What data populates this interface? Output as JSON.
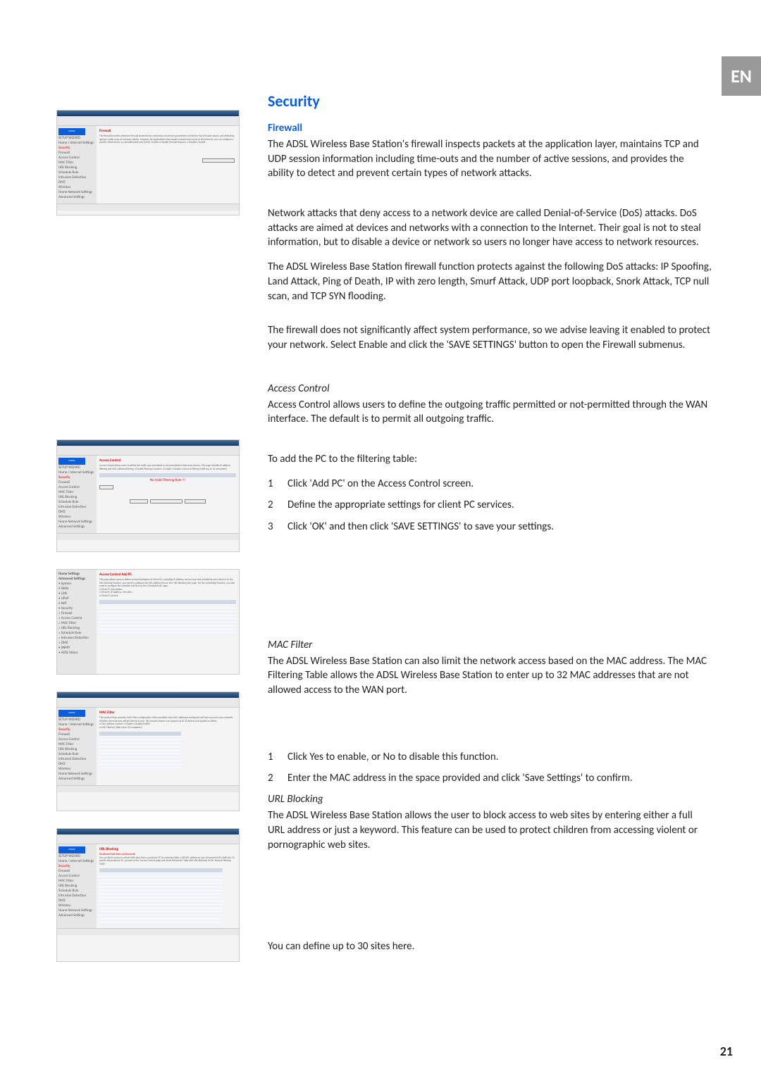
{
  "lang_tab": "EN",
  "page_number": "21",
  "section_title": "Security",
  "firewall": {
    "heading": "Firewall",
    "p1": "The ADSL Wireless Base Station's firewall inspects packets at the application layer, maintains TCP and UDP session information including time-outs and the number of active sessions, and provides the ability to detect and prevent certain types of network attacks.",
    "p2": "Network attacks that deny access to a network device are called Denial-of-Service (DoS) attacks. DoS attacks are aimed at devices and networks with a connection to the Internet. Their goal is not to steal information, but to disable a device or network so users no longer have access to network resources.",
    "p3": "The ADSL Wireless Base Station firewall function protects against the following DoS attacks: IP Spoofing, Land Attack, Ping of Death, IP with zero length, Smurf Attack, UDP port loopback, Snork Attack, TCP null scan, and TCP SYN flooding.",
    "p4": "The firewall does not significantly affect system performance, so we advise leaving it enabled to protect your network. Select Enable and click the 'SAVE SETTINGS' button to open the Firewall submenus."
  },
  "access_control": {
    "heading": "Access Control",
    "p1": "Access Control allows users to define the outgoing traffic permitted or not-permitted through the WAN interface. The default is to permit all outgoing traffic.",
    "lead": "To add the PC to the filtering table:",
    "steps": [
      "Click 'Add PC' on the Access Control screen.",
      "Define the appropriate settings for client PC services.",
      "Click 'OK' and then click 'SAVE SETTINGS' to save your settings."
    ]
  },
  "mac_filter": {
    "heading": "MAC Filter",
    "p1": "The ADSL Wireless Base Station can also limit the network access based on the MAC address. The MAC Filtering Table allows the ADSL Wireless Base Station to enter up to 32 MAC addresses that are not allowed access to the WAN port.",
    "steps": [
      "Click Yes to enable, or No to disable this function.",
      "Enter the MAC address in the space provided and click 'Save Settings' to confirm."
    ]
  },
  "url_blocking": {
    "heading": "URL Blocking",
    "p1": "The ADSL Wireless Base Station allows the user to block access to web sites by entering either a full URL address or just a keyword. This feature can be used to protect children from accessing violent or pornographic web sites.",
    "p2": "You can define up to 30 sites here."
  },
  "shot_common": {
    "logo": "PHILIPS"
  },
  "shot1": {
    "title": "Firewall",
    "sidebar": [
      "SETUP WIZARD",
      "Home / Internet Settings",
      "Security",
      "Firewall",
      "Access Control",
      "MAC Filter",
      "URL Blocking",
      "Schedule Rule",
      "Intrusion Detection",
      "DMZ",
      "Wireless",
      "Home Network Settings",
      "Advanced Settings"
    ],
    "text": "The firewall provides extensive firewall protection by restricting connection parameters to limit the risk of hacker attack, and defending against a wide array of common attacks. However, for applications that require unrestricted access to the Internet, you can configure a specific client/server as a demilitarized zone (DMZ). Enable or disable Firewall features: ○ Disable ○ Enable",
    "btn": "SAVE SETTINGS"
  },
  "shot2": {
    "title": "Access Control",
    "sidebar": [
      "SETUP WIZARD",
      "Home / Internet Settings",
      "Security",
      "Firewall",
      "Access Control",
      "MAC Filter",
      "URL Blocking",
      "Schedule Rule",
      "Intrusion Detection",
      "DMZ",
      "Wireless",
      "Home Network Settings",
      "Advanced Settings"
    ],
    "text": "Access Control allows users to define the traffic type permitted or not-permitted to WAN port service. This page includes IP address filtering and MAC address filtering. • Enable Filtering Function: ○ Enable ○ Disable • Normal Filtering Table (up to 10 computers)",
    "tbl_hdr": [
      "Rule Description",
      "Client PC IP Address",
      "Client Service",
      "Schedule Rule",
      "Configure"
    ],
    "tbl_msg": "No Valid Filtering Rule !!!",
    "btns": [
      "Add PC",
      "HELP",
      "SAVE SETTINGS",
      "CANCEL"
    ]
  },
  "shot3": {
    "title": "Access Control Add PC",
    "sidebar": [
      "Home Settings",
      "Advanced Settings",
      "• System",
      "• WAN",
      "• LAN",
      "• UPnP",
      "• NAT",
      "• Security",
      "  » Firewall",
      "  » Access Control",
      "  » MAC Filter",
      "  » URL Blocking",
      "  » Schedule Rule",
      "  » Intrusion Detection",
      "  » DMZ",
      "• SNMP",
      "• ADSL Status"
    ],
    "text": "This page allows users to define service limitations of client PCs, including IP address, service type and scheduling rule criteria. For the URL blocking function, you need to configure the URL address first on the 'URL Blocking Site' page. For the scheduling function, you also need to configure the schedule rule first on the 'Schedule Rule' page.",
    "fields": [
      "• Client PC Description:",
      "• Client PC IP Address: 192.168.1."
    ],
    "svc_title": "• Client PC Service:",
    "svc_hdr": [
      "Service Name",
      "Detail Description",
      "Blocking"
    ],
    "svc_rows": [
      [
        "WWW",
        "HTTP, TCP Port 80, 3128, 8000, 8080, 8081",
        ""
      ],
      [
        "WWW with URL Blocking",
        "HTTP (Ref. URL Blocking Site Page)",
        ""
      ],
      [
        "E-mail Sending",
        "SMTP, TCP Port 25",
        ""
      ],
      [
        "News Forums",
        "NNTP, TCP Port 119",
        ""
      ],
      [
        "E-mail Receiving",
        "POP3, TCP Port 110",
        ""
      ],
      [
        "Secure HTTP",
        "HTTPS, TCP Port 443",
        ""
      ],
      [
        "File Transfer",
        "FTP, TCP Port 21",
        ""
      ],
      [
        "Telnet Service",
        "TCP Port 23",
        ""
      ],
      [
        "AIM",
        "AOL Instant Messenger, TCP Port 5190",
        ""
      ]
    ]
  },
  "shot4": {
    "title": "MAC Filter",
    "sidebar": [
      "SETUP WIZARD",
      "Home / Internet Settings",
      "Security",
      "Firewall",
      "Access Control",
      "MAC Filter",
      "URL Blocking",
      "Schedule Rule",
      "Intrusion Detection",
      "DMZ",
      "Wireless",
      "Home Network Settings",
      "Advanced Settings"
    ],
    "text": "This section helps provides MAC Filter configuration. When enabled, only MAC addresses configured will have access to your network. All other client devices will get denied access. This security feature can support up to 32 devices and applies to clients.",
    "t1": "• MAC Address Control: ○ Enable ○ Disable/Enable",
    "t2": "• MAC Filtering Table (up to 32 computers)",
    "hdr": [
      "ID",
      "MAC Address"
    ]
  },
  "shot5": {
    "title": "URL Blocking",
    "subtitle": "Disallowed Web Sites and Keywords",
    "sidebar": [
      "SETUP WIZARD",
      "Home / Internet Settings",
      "Security",
      "Firewall",
      "Access Control",
      "MAC Filter",
      "URL Blocking",
      "Schedule Rule",
      "Intrusion Detection",
      "DMZ",
      "Wireless",
      "Home Network Settings",
      "Advanced Settings"
    ],
    "text": "You can block access to certain Web sites from a particular PC by entering either a full URL address or just a keyword of the Web site. To specify the particular PC, go back to the 'Access Control' page and check the box for 'Http with URL Blocking' in the 'Normal Filtering Table'.",
    "hdr": [
      "Rule Number",
      "URL / Keyword",
      "Rule Number",
      "URL / Keyword"
    ],
    "sites_l": [
      "Site 1",
      "Site 2",
      "Site 3",
      "Site 4",
      "Site 5",
      "Site 6",
      "Site 7",
      "Site 8",
      "Site 9",
      "Site 10",
      "Site 11",
      "Site 12",
      "Site 13",
      "Site 14",
      "Site 15"
    ],
    "sites_r": [
      "Site 16",
      "Site 17",
      "Site 18",
      "Site 19",
      "Site 20",
      "Site 21",
      "Site 22",
      "Site 23",
      "Site 24",
      "Site 25",
      "Site 26",
      "Site 27",
      "Site 28",
      "Site 29",
      "Site 30"
    ]
  }
}
